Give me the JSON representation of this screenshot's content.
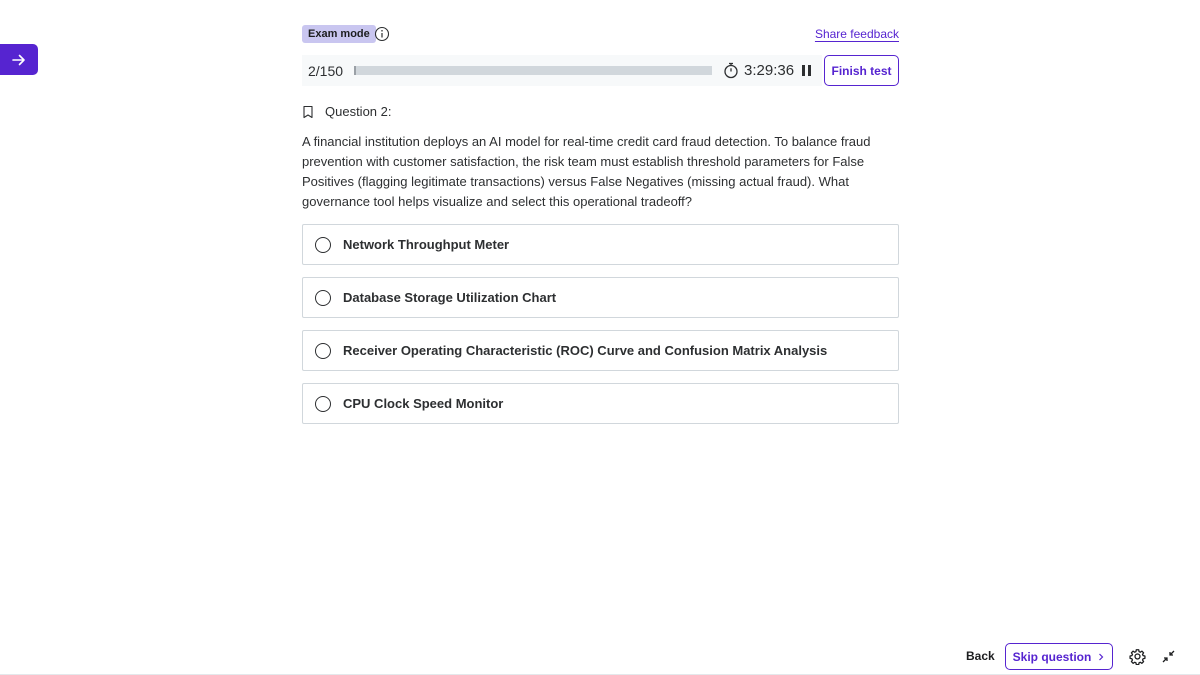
{
  "sidebar": {
    "toggle_icon": "arrow-right-icon",
    "accent": "#5624d0"
  },
  "header": {
    "mode_badge": "Exam mode",
    "info_icon": "info-circle-icon",
    "feedback_link": "Share feedback"
  },
  "progress": {
    "counter": "2/150",
    "current": 2,
    "total": 150,
    "timer": "3:29:36",
    "timer_icon": "stopwatch-icon",
    "pause_icon": "pause-icon",
    "finish_label": "Finish test"
  },
  "question": {
    "bookmark_icon": "bookmark-icon",
    "label": "Question 2:",
    "text": "A financial institution deploys an AI model for real-time credit card fraud detection. To balance fraud prevention with customer satisfaction, the risk team must establish threshold parameters for False Positives (flagging legitimate transactions) versus False Negatives (missing actual fraud). What governance tool helps visualize and select this operational tradeoff?",
    "options": [
      {
        "label": "Network Throughput Meter"
      },
      {
        "label": "Database Storage Utilization Chart"
      },
      {
        "label": "Receiver Operating Characteristic (ROC) Curve and Confusion Matrix Analysis"
      },
      {
        "label": "CPU Clock Speed Monitor"
      }
    ]
  },
  "footer": {
    "back_label": "Back",
    "skip_label": "Skip question",
    "skip_icon": "chevron-right-icon",
    "settings_icon": "gear-icon",
    "collapse_icon": "collapse-icon"
  }
}
